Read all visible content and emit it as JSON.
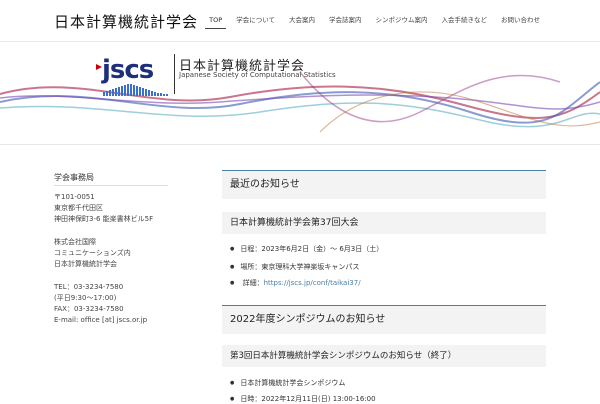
{
  "header": {
    "site_title": "日本計算機統計学会",
    "nav": [
      "TOP",
      "学会について",
      "大会案内",
      "学会誌案内",
      "シンポジウム案内",
      "入会手続きなど",
      "お問い合わせ"
    ]
  },
  "banner": {
    "logo_mark": "jscs",
    "logo_jp": "日本計算機統計学会",
    "logo_en": "Japanese Society of Computational Statistics"
  },
  "sidebar": {
    "title": "学会事務局",
    "address1": "〒101-0051\n東京都千代田区\n神田神保町3-6 能楽書林ビル5F",
    "address2": "株式会社国際\nコミュニケーションズ内\n日本計算機統計学会",
    "contact": "TEL：03-3234-7580\n(平日9:30～17:00)\nFAX：03-3234-7580\nE-mail: office [at] jscs.or.jp"
  },
  "main": {
    "section_title": "最近のお知らせ",
    "meeting_title": "日本計算機統計学会第37回大会",
    "meeting_items": {
      "date": "日程：2023年6月2日（金）～ 6月3日（土）",
      "venue": "場所：東京理科大学神楽坂キャンパス",
      "url_label": "詳細：",
      "url": "https://jscs.jp/conf/taikai37/"
    },
    "symposium_section": "2022年度シンポジウムのお知らせ",
    "symposium_title": "第3回日本計算機統計学会シンポジウムのお知らせ（終了）",
    "symposium_items": {
      "item1": "日本計算機統計学会シンポジウム",
      "item2": "日時：2022年12月11日(日) 13:00-16:00"
    }
  }
}
